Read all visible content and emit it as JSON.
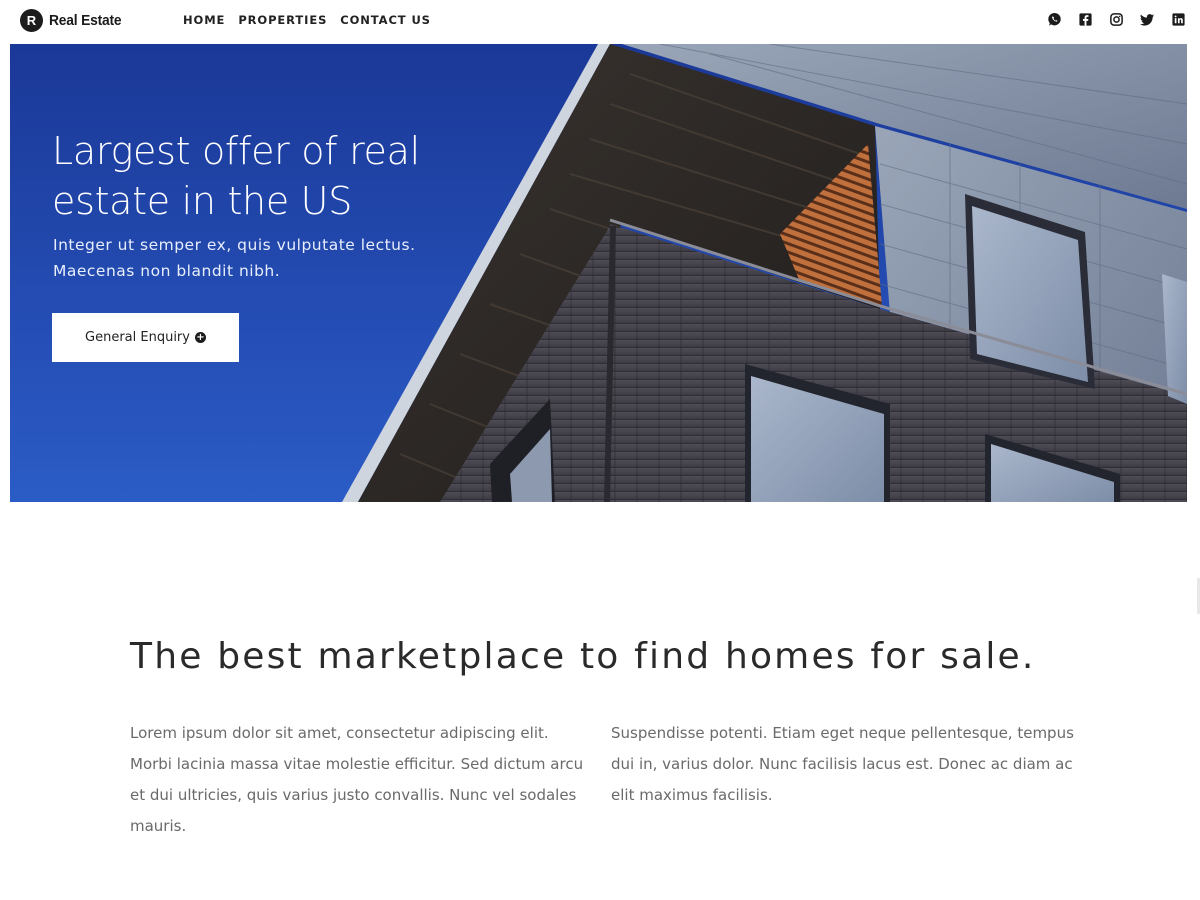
{
  "brand": {
    "mark": "R",
    "name": "Real Estate"
  },
  "nav": {
    "links": [
      {
        "label": "HOME"
      },
      {
        "label": "PROPERTIES"
      },
      {
        "label": "CONTACT US"
      }
    ]
  },
  "social": [
    {
      "icon": "whatsapp-icon"
    },
    {
      "icon": "facebook-icon"
    },
    {
      "icon": "instagram-icon"
    },
    {
      "icon": "twitter-icon"
    },
    {
      "icon": "linkedin-icon"
    }
  ],
  "hero": {
    "title": "Largest offer of real estate in the US",
    "subtitle_line1": "Integer ut semper ex, quis vulputate lectus.",
    "subtitle_line2": "Maecenas non blandit nibh.",
    "button_label": "General Enquiry",
    "button_icon": "plus-circle-icon",
    "sky_color": "#2550b8"
  },
  "intro": {
    "heading": "The best marketplace to find homes for sale.",
    "col1": "Lorem ipsum dolor sit amet, consectetur adipiscing elit. Morbi lacinia massa vitae molestie efficitur. Sed dictum arcu et dui ultricies, quis varius justo convallis. Nunc vel sodales mauris.",
    "col2": "Suspendisse potenti. Etiam eget neque pellentesque, tempus dui in, varius dolor. Nunc facilisis lacus est. Donec ac diam ac elit maximus facilisis."
  }
}
